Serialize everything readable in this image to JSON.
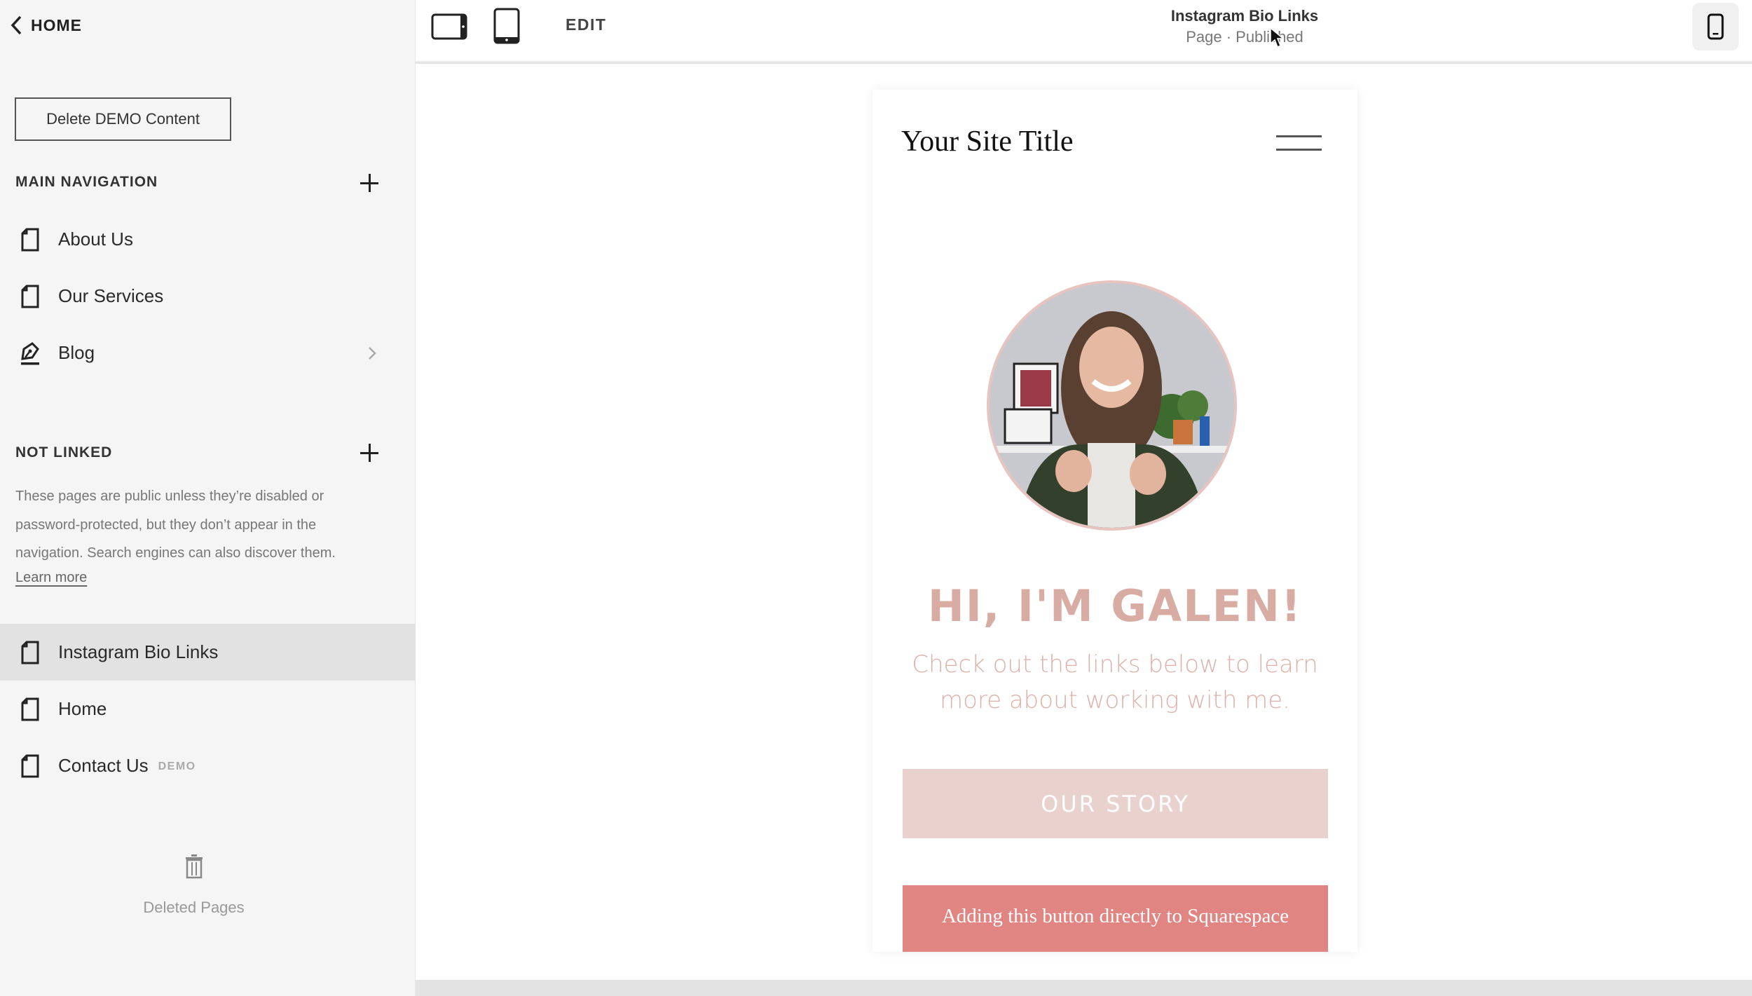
{
  "sidebar": {
    "back_label": "HOME",
    "delete_demo_label": "Delete DEMO Content",
    "main_navigation": {
      "title": "MAIN NAVIGATION",
      "items": [
        {
          "label": "About Us",
          "icon": "page-icon"
        },
        {
          "label": "Our Services",
          "icon": "page-icon"
        },
        {
          "label": "Blog",
          "icon": "blog-icon",
          "has_children": true
        }
      ]
    },
    "not_linked": {
      "title": "NOT LINKED",
      "description": "These pages are public unless they’re disabled or password-protected, but they don’t appear in the navigation. Search engines can also discover them.",
      "learn_more": "Learn more",
      "items": [
        {
          "label": "Instagram Bio Links",
          "icon": "page-icon",
          "selected": true
        },
        {
          "label": "Home",
          "icon": "page-icon"
        },
        {
          "label": "Contact Us",
          "icon": "page-icon",
          "badge": "DEMO"
        }
      ]
    },
    "deleted_pages_label": "Deleted Pages"
  },
  "topbar": {
    "edit_label": "EDIT",
    "page_title": "Instagram Bio Links",
    "page_status": "Page · Published",
    "view_modes": [
      "tablet-landscape",
      "tablet-portrait",
      "mobile"
    ],
    "active_view": "mobile"
  },
  "preview": {
    "site_title": "Your Site Title",
    "headline": "HI, I'M GALEN!",
    "intro": "Check out the links below to learn more about working with me.",
    "buttons": [
      {
        "label": "OUR STORY"
      },
      {
        "label": "Adding this button directly to Squarespace"
      }
    ],
    "colors": {
      "headline": "#d9aca3",
      "intro": "#ddb0a8",
      "button_light": "#e9d2ce",
      "button_red": "#e08581",
      "avatar_border": "#e8c4c0"
    }
  }
}
